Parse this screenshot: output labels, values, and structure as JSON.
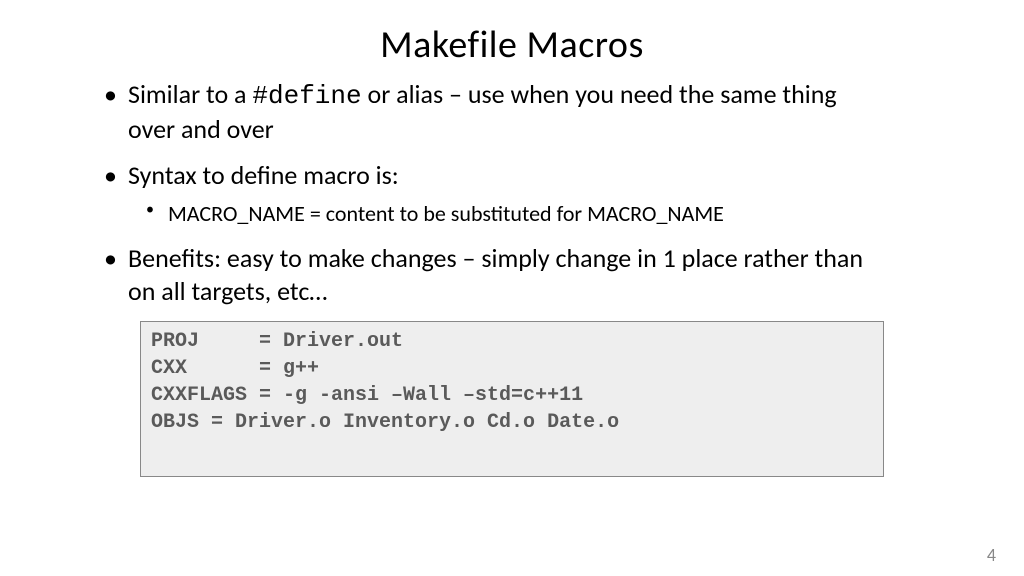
{
  "title": "Makefile Macros",
  "bullets": {
    "b1_pre": "Similar to a ",
    "b1_code": "#define",
    "b1_post": " or alias – use when you need the same thing over and over",
    "b2": "Syntax to define macro is:",
    "b2_sub": "MACRO_NAME = content to be substituted for MACRO_NAME",
    "b3": "Benefits: easy to make changes – simply change in 1 place rather than on all targets, etc…"
  },
  "code": {
    "l1": "PROJ     = Driver.out",
    "l2": "CXX      = g++",
    "l3": "CXXFLAGS = -g -ansi –Wall –std=c++11",
    "l4": "OBJS = Driver.o Inventory.o Cd.o Date.o"
  },
  "page": "4"
}
